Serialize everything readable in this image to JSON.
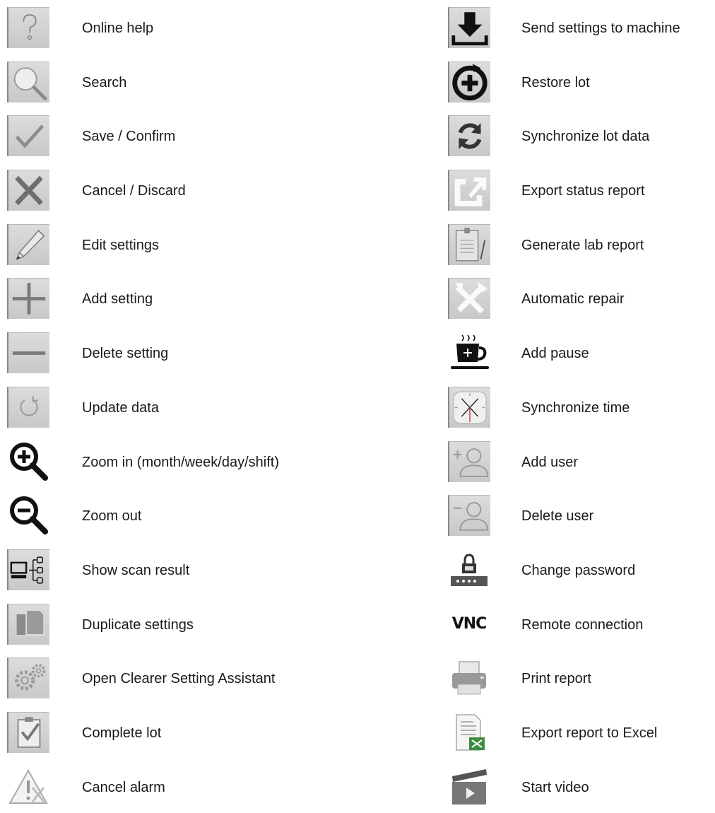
{
  "left_items": [
    {
      "icon": "question-icon",
      "label": "Online help"
    },
    {
      "icon": "magnifier-icon",
      "label": "Search"
    },
    {
      "icon": "checkmark-icon",
      "label": "Save / Confirm"
    },
    {
      "icon": "cross-icon",
      "label": "Cancel / Discard"
    },
    {
      "icon": "pencil-icon",
      "label": "Edit settings"
    },
    {
      "icon": "plus-icon",
      "label": "Add setting"
    },
    {
      "icon": "minus-icon",
      "label": "Delete setting"
    },
    {
      "icon": "refresh-icon",
      "label": "Update data"
    },
    {
      "icon": "zoom-in-icon",
      "label": "Zoom in (month/week/day/shift)"
    },
    {
      "icon": "zoom-out-icon",
      "label": "Zoom out"
    },
    {
      "icon": "scan-result-icon",
      "label": "Show scan result"
    },
    {
      "icon": "duplicate-icon",
      "label": "Duplicate settings"
    },
    {
      "icon": "gears-icon",
      "label": "Open Clearer Setting Assistant"
    },
    {
      "icon": "clipboard-check-icon",
      "label": "Complete lot"
    },
    {
      "icon": "alarm-cancel-icon",
      "label": "Cancel alarm"
    }
  ],
  "right_items": [
    {
      "icon": "download-icon",
      "label": "Send settings to machine"
    },
    {
      "icon": "restore-icon",
      "label": "Restore lot"
    },
    {
      "icon": "sync-icon",
      "label": "Synchronize lot data"
    },
    {
      "icon": "export-icon",
      "label": "Export status report"
    },
    {
      "icon": "lab-report-icon",
      "label": "Generate lab report"
    },
    {
      "icon": "tools-icon",
      "label": "Automatic repair"
    },
    {
      "icon": "coffee-cup-icon",
      "label": "Add pause"
    },
    {
      "icon": "clock-icon",
      "label": "Synchronize time"
    },
    {
      "icon": "add-user-icon",
      "label": "Add user"
    },
    {
      "icon": "delete-user-icon",
      "label": "Delete user"
    },
    {
      "icon": "password-icon",
      "label": "Change password"
    },
    {
      "icon": "vnc-icon",
      "label": "Remote connection",
      "icon_text": "VNC"
    },
    {
      "icon": "printer-icon",
      "label": "Print report"
    },
    {
      "icon": "excel-icon",
      "label": "Export report to Excel"
    },
    {
      "icon": "video-icon",
      "label": "Start video"
    }
  ]
}
